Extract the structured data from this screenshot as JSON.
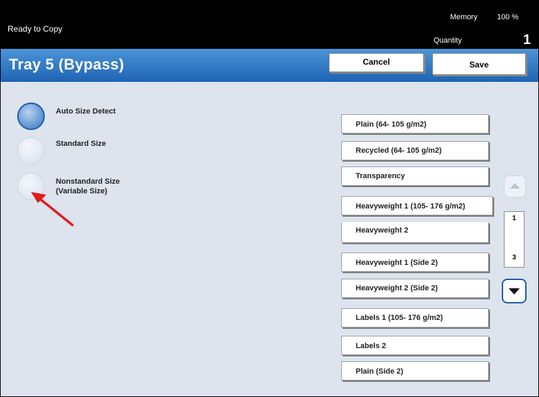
{
  "status": {
    "ready_text": "Ready to Copy",
    "memory_label": "Memory",
    "memory_value": "100 %",
    "quantity_label": "Quantity",
    "quantity_value": "1"
  },
  "header": {
    "title": "Tray 5 (Bypass)",
    "cancel_label": "Cancel",
    "save_label": "Save",
    "accent_color": "#2a6fc0"
  },
  "size_options": [
    {
      "label_lines": [
        "Auto Size Detect"
      ],
      "selected": true
    },
    {
      "label_lines": [
        "Standard Size"
      ],
      "selected": false
    },
    {
      "label_lines": [
        "Nonstandard Size",
        "(Variable Size)"
      ],
      "selected": false
    }
  ],
  "paper_types": [
    "Plain (64- 105 g/m2)",
    "Recycled (64- 105 g/m2)",
    "Transparency",
    "Heavyweight 1 (105- 176 g/m2)",
    "Heavyweight 2",
    "Heavyweight 1 (Side 2)",
    "Heavyweight 2 (Side 2)",
    "Labels 1 (105- 176 g/m2)",
    "Labels 2",
    "Plain (Side 2)"
  ],
  "pagination": {
    "current": "1",
    "total": "3"
  },
  "annotation": {
    "arrow_color": "#e21b1b",
    "icon": "red-arrow-icon"
  }
}
